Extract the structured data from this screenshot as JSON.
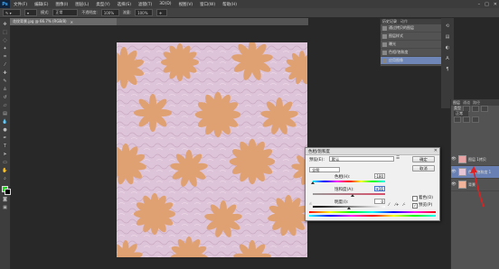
{
  "menubar": {
    "logo": "Ps",
    "items": [
      "文件(F)",
      "编辑(E)",
      "图像(I)",
      "图层(L)",
      "类型(Y)",
      "选择(S)",
      "滤镜(T)",
      "3D(D)",
      "视图(V)",
      "窗口(W)",
      "帮助(H)"
    ],
    "window_controls": [
      "–",
      "□",
      "✕"
    ]
  },
  "options_bar": {
    "mode_label": "模式:",
    "mode_value": "正常",
    "opacity_label": "不透明度:",
    "opacity_value": "100%",
    "flow_label": "流量:",
    "flow_value": "100%"
  },
  "document_tab": {
    "title": "花纹背景.jpg @ 66.7% (RGB/8)",
    "close": "×"
  },
  "history_panel": {
    "tabs": [
      "历史记录",
      "动作"
    ],
    "items": [
      {
        "label": "通过拷贝的图层",
        "active": false
      },
      {
        "label": "图层样式",
        "active": false
      },
      {
        "label": "曝光",
        "active": false
      },
      {
        "label": "色相/饱和度",
        "active": false
      },
      {
        "label": "应用图像",
        "active": true
      }
    ]
  },
  "layers_panel": {
    "tabs": [
      "图层",
      "通道",
      "路径"
    ],
    "kind_label": "类型",
    "blend_mode": "正常",
    "layers": [
      {
        "name": "图层 1拷贝",
        "thumb_color": "#e8a4a4",
        "active": false
      },
      {
        "name": "色相/饱和度 1",
        "thumb_color": "#e6c6d6",
        "active": true
      },
      {
        "name": "背景",
        "thumb_color": "#f2b49a",
        "active": false
      }
    ]
  },
  "dialog": {
    "title": "色相/饱和度",
    "close": "✕",
    "preset_label": "预设(E):",
    "preset_value": "默认",
    "channel_value": "全图",
    "hue_label": "色相(H):",
    "hue_value": "-180",
    "saturation_label": "饱和度(A):",
    "saturation_value": "+11",
    "lightness_label": "明度(I):",
    "lightness_value": "0",
    "colorize_label": "着色(O)",
    "colorize_checked": false,
    "preview_label": "预览(P)",
    "preview_checked": true,
    "ok_label": "确定",
    "cancel_label": "取消",
    "hue_level": 0.0,
    "saturation_level": 0.555,
    "lightness_level": 0.5
  },
  "colors": {
    "canvas_bg": "#dec4d8",
    "petal": "#e0a172",
    "foreground": "#1fd81a",
    "background": "#000000",
    "annotation_arrow": "#e02020"
  }
}
